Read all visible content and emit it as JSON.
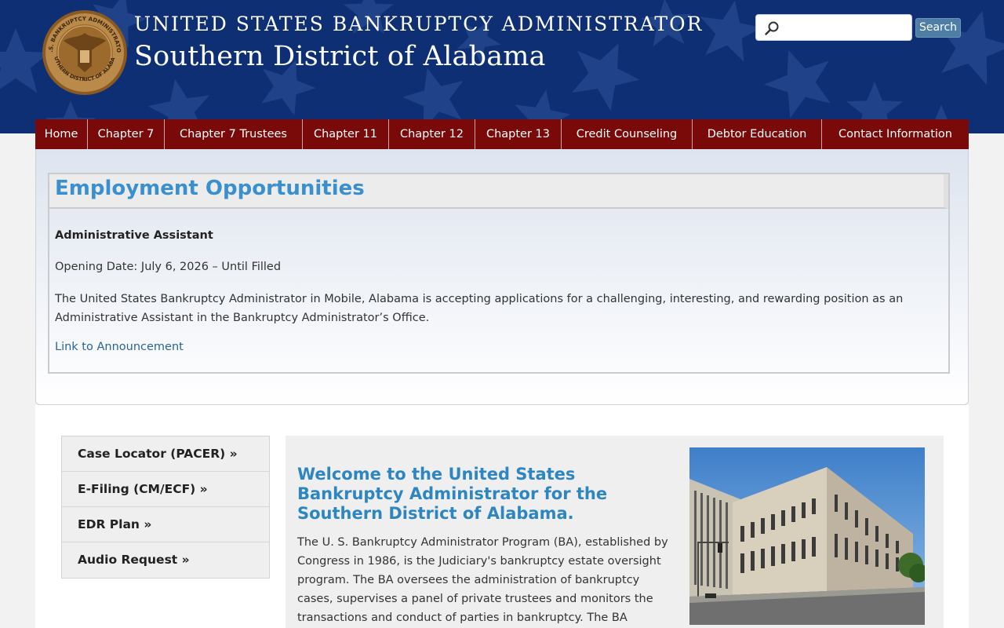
{
  "header": {
    "title_top": "UNITED STATES BANKRUPTCY ADMINISTRATOR",
    "title_main": "Southern District of Alabama",
    "seal_text_top": "U.S. BANKRUPTCY ADMINISTRATOR",
    "seal_text_bottom": "SOUTHERN DISTRICT OF ALABAMA",
    "search": {
      "placeholder": "",
      "value": "",
      "button_label": "Search"
    }
  },
  "nav": {
    "items": [
      {
        "label": "Home"
      },
      {
        "label": "Chapter 7"
      },
      {
        "label": "Chapter 7 Trustees"
      },
      {
        "label": "Chapter 11"
      },
      {
        "label": "Chapter 12"
      },
      {
        "label": "Chapter 13"
      },
      {
        "label": "Credit Counseling"
      },
      {
        "label": "Debtor Education"
      },
      {
        "label": "Contact Information"
      }
    ]
  },
  "announcement": {
    "title": "Employment Opportunities",
    "job_title": "Administrative Assistant",
    "opening_date": "Opening Date: July 6, 2026 – Until Filled",
    "description": "The United States Bankruptcy Administrator in Mobile, Alabama is accepting applications for a challenging, interesting, and rewarding position as an Administrative Assistant in the Bankruptcy Administrator’s Office.",
    "link_label": "Link to Announcement"
  },
  "sidebar": {
    "items": [
      {
        "label": "Case Locator (PACER) »"
      },
      {
        "label": "E-Filing (CM/ECF) »"
      },
      {
        "label": "EDR Plan »"
      },
      {
        "label": "Audio Request »"
      }
    ]
  },
  "main": {
    "welcome_title": "Welcome to the United States Bankruptcy Administrator for the Southern District of Alabama.",
    "welcome_text": "The U. S. Bankruptcy Administrator Program (BA), established by Congress in 1986, is the Judiciary's bankruptcy estate oversight program. The BA oversees the administration of bankruptcy cases, supervises a panel of private trustees and monitors the transactions and conduct of parties in bankruptcy. The BA program consists of six"
  },
  "colors": {
    "header_bg": "#0e2f74",
    "nav_bg": "#7a0a0a",
    "title_blue": "#3a8fce",
    "link_blue": "#2a6496",
    "seal_gold": "#9c6a2c"
  },
  "icons": {
    "search": "magnifier-icon",
    "seal": "eagle-seal-icon"
  }
}
